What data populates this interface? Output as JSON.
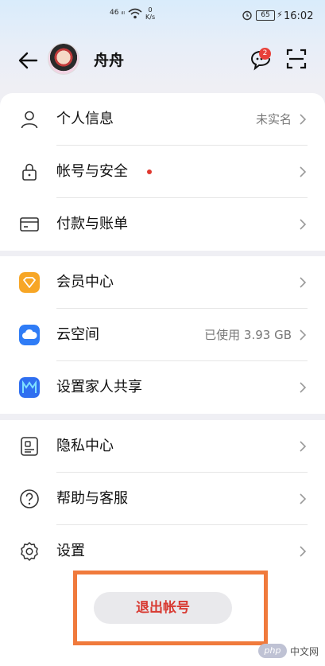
{
  "status_bar": {
    "network": "46 ᵢₗₗ",
    "speed_value": "0",
    "speed_unit": "K/s",
    "battery": "65",
    "time": "16:02"
  },
  "header": {
    "username": "舟舟",
    "message_badge": "2"
  },
  "groups": [
    [
      {
        "label": "个人信息",
        "value": "未实名",
        "icon": "person-icon"
      },
      {
        "label": "帐号与安全",
        "value": "",
        "icon": "lock-icon",
        "dot": true
      },
      {
        "label": "付款与账单",
        "value": "",
        "icon": "card-icon"
      }
    ],
    [
      {
        "label": "会员中心",
        "value": "",
        "icon": "member-center-icon",
        "color": "#f7a626"
      },
      {
        "label": "云空间",
        "value": "已使用 3.93 GB",
        "icon": "cloud-icon",
        "color": "#2f7cf6"
      },
      {
        "label": "设置家人共享",
        "value": "",
        "icon": "family-share-icon",
        "color": "#2f6ff0"
      }
    ],
    [
      {
        "label": "隐私中心",
        "value": "",
        "icon": "privacy-icon"
      },
      {
        "label": "帮助与客服",
        "value": "",
        "icon": "help-icon"
      },
      {
        "label": "设置",
        "value": "",
        "icon": "settings-icon"
      }
    ]
  ],
  "logout": {
    "label": "退出帐号"
  },
  "watermark": {
    "logo": "php",
    "text": "中文网"
  }
}
